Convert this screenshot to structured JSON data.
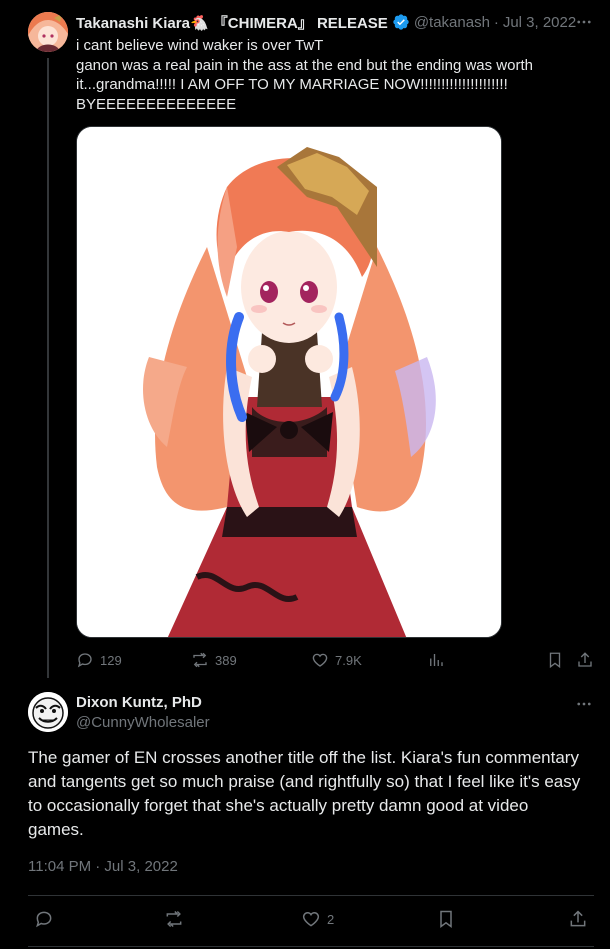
{
  "tweet1": {
    "author_name": "Takanashi Kiara🐔 『CHIMERA』 RELEASE",
    "handle": "@takanash",
    "separator": "·",
    "date": "Jul 3, 2022",
    "verified_icon": "verified-badge-icon",
    "text": "i cant believe wind waker is over TwT\nganon was a real pain in the ass at the end but the ending was worth it...grandma!!!!! I AM OFF TO MY MARRIAGE NOW!!!!!!!!!!!!!!!!!!!!!\nBYEEEEEEEEEEEEEE",
    "media_icon": "character-illustration-image",
    "actions": {
      "reply_count": "129",
      "retweet_count": "389",
      "like_count": "7.9K",
      "views_icon": "analytics-icon",
      "bookmark_icon": "bookmark-icon",
      "share_icon": "share-icon"
    }
  },
  "tweet2": {
    "author_name": "Dixon Kuntz, PhD",
    "handle": "@CunnyWholesaler",
    "text": "The gamer of EN crosses another title off the list. Kiara's fun commentary and tangents get so much praise (and rightfully so) that I feel like it's easy to occasionally forget that she's actually pretty damn good at video games.",
    "timestamp": "11:04 PM · Jul 3, 2022",
    "actions": {
      "reply_count": "",
      "retweet_count": "",
      "like_count": "2",
      "bookmark_icon": "bookmark-icon",
      "share_icon": "share-icon"
    }
  },
  "colors": {
    "background": "#000000",
    "primary_text": "#e7e9ea",
    "secondary_text": "#71767b",
    "verified_blue": "#1d9bf0",
    "divider": "#2f3336"
  }
}
